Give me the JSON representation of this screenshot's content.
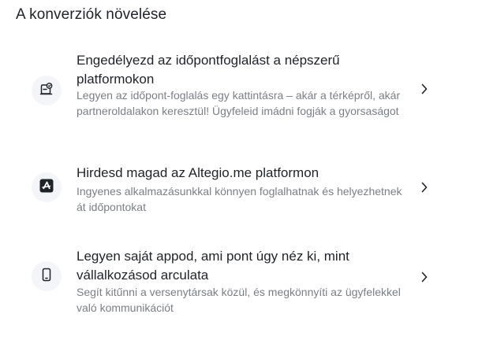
{
  "section": {
    "title": "A konverziók növelése"
  },
  "items": [
    {
      "title": "Engedélyezd az időpontfoglalást a népszerű platformokon",
      "description": "Legyen az időpont-foglalás egy kattintásra – akár a térképről, akár partneroldalakon keresztül! Ügyfeleid imádni fogják a gyorsaságot",
      "icon": "booking-widget-icon"
    },
    {
      "title": "Hirdesd magad az Altegio.me platformon",
      "description": "Ingyenes alkalmazásunkkal könnyen foglalhatnak és helyezhetnek át időpontokat",
      "icon": "altegio-logo-icon"
    },
    {
      "title": "Legyen saját appod, ami pont úgy néz ki, mint vállalkozásod arculata",
      "description": "Segít kitűnni a versenytársak közül, és megkönnyíti az ügyfelekkel való kommunikációt",
      "icon": "smartphone-icon"
    }
  ],
  "colors": {
    "title_text": "#1f2329",
    "description_text": "#7a7f86",
    "icon_background": "#f3f5f8",
    "logo_dark": "#1f2329"
  }
}
